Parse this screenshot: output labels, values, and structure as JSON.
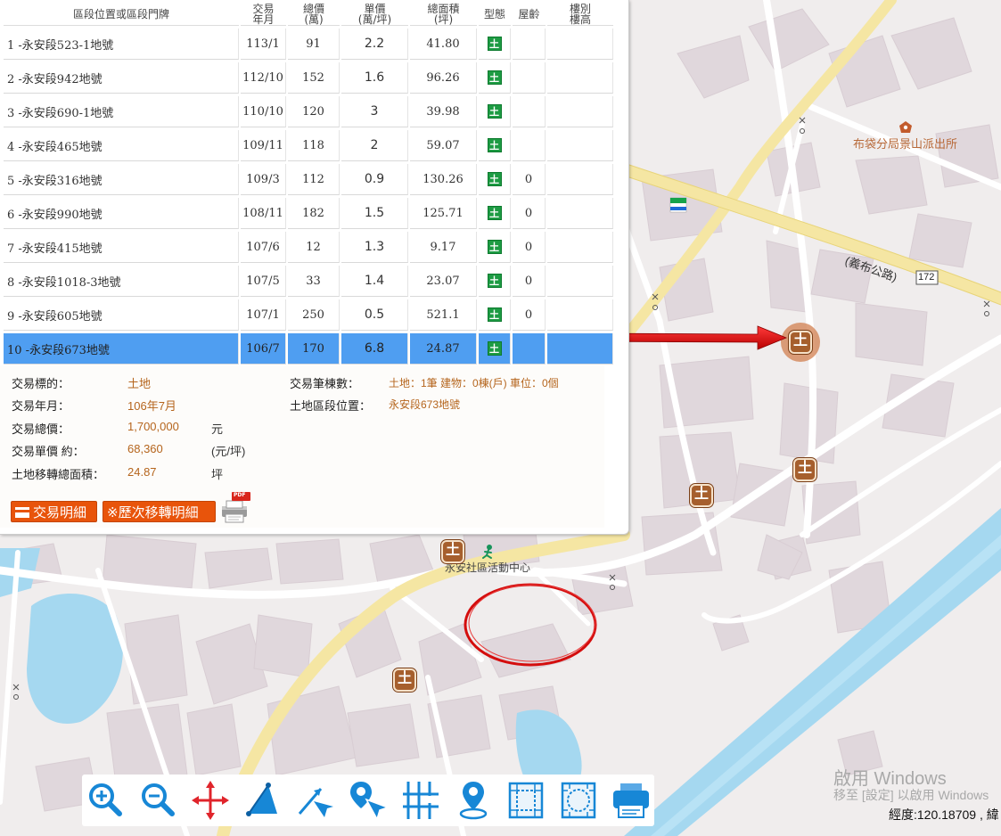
{
  "table": {
    "headers": [
      {
        "l1": "區段位置或區段門牌",
        "l2": ""
      },
      {
        "l1": "交易",
        "l2": "年月"
      },
      {
        "l1": "總價",
        "l2": "(萬)"
      },
      {
        "l1": "單價",
        "l2": "(萬/坪)"
      },
      {
        "l1": "總面積",
        "l2": "(坪)"
      },
      {
        "l1": "型態",
        "l2": ""
      },
      {
        "l1": "屋齡",
        "l2": ""
      },
      {
        "l1": "樓別",
        "l2": "樓高"
      }
    ],
    "type_badge": "土",
    "rows": [
      {
        "addr": "1 -永安段523-1地號",
        "date": "113/1",
        "total": "91",
        "unit": "2.2",
        "area": "41.80",
        "age": ""
      },
      {
        "addr": "2 -永安段942地號",
        "date": "112/10",
        "total": "152",
        "unit": "1.6",
        "area": "96.26",
        "age": ""
      },
      {
        "addr": "3 -永安段690-1地號",
        "date": "110/10",
        "total": "120",
        "unit": "3",
        "area": "39.98",
        "age": ""
      },
      {
        "addr": "4 -永安段465地號",
        "date": "109/11",
        "total": "118",
        "unit": "2",
        "area": "59.07",
        "age": ""
      },
      {
        "addr": "5 -永安段316地號",
        "date": "109/3",
        "total": "112",
        "unit": "0.9",
        "area": "130.26",
        "age": "0"
      },
      {
        "addr": "6 -永安段990地號",
        "date": "108/11",
        "total": "182",
        "unit": "1.5",
        "area": "125.71",
        "age": "0"
      },
      {
        "addr": "7 -永安段415地號",
        "date": "107/6",
        "total": "12",
        "unit": "1.3",
        "area": "9.17",
        "age": "0"
      },
      {
        "addr": "8 -永安段1018-3地號",
        "date": "107/5",
        "total": "33",
        "unit": "1.4",
        "area": "23.07",
        "age": "0"
      },
      {
        "addr": "9 -永安段605地號",
        "date": "107/1",
        "total": "250",
        "unit": "0.5",
        "area": "521.1",
        "age": "0"
      },
      {
        "addr": "10 -永安段673地號",
        "date": "106/7",
        "total": "170",
        "unit": "6.8",
        "area": "24.87",
        "age": ""
      }
    ]
  },
  "detail": {
    "subject_label": "交易標的：",
    "subject_value": "土地",
    "date_label": "交易年月：",
    "date_value": "106年7月",
    "total_label": "交易總價：",
    "total_value": "1,700,000",
    "total_unit": "元",
    "unit_label": "交易單價 約：",
    "unit_value": "68,360",
    "unit_unit": "(元/坪)",
    "area_label": "土地移轉總面積：",
    "area_value": "24.87",
    "area_unit": "坪",
    "count_label": "交易筆棟數：",
    "count_value": "土地：1筆 建物：0棟(戶) 車位：0個",
    "location_label": "土地區段位置：",
    "location_value": "永安段673地號"
  },
  "buttons": {
    "details": "交易明細",
    "history": "※歷次移轉明細",
    "pdf_badge": "PDF"
  },
  "map": {
    "police": "布袋分局景山派出所",
    "road": "(義布公路)",
    "route_no": "172",
    "community": "永安社區活動中心",
    "marker_label": "土",
    "coord_label": "經度:120.18709 , 緯",
    "windows_title": "啟用 Windows",
    "windows_sub": "移至 [設定] 以啟用 Windows",
    "road_marker": "O"
  },
  "toolbar": [
    {
      "name": "zoom-in-tool",
      "icon": "zoom-in-icon"
    },
    {
      "name": "zoom-out-tool",
      "icon": "zoom-out-icon"
    },
    {
      "name": "pan-tool",
      "icon": "move-arrows-icon"
    },
    {
      "name": "measure-area-tool",
      "icon": "triangle-area-icon"
    },
    {
      "name": "measure-distance-tool",
      "icon": "ruler-arrow-icon"
    },
    {
      "name": "point-query-tool",
      "icon": "pin-pointer-icon"
    },
    {
      "name": "road-tool",
      "icon": "road-grid-icon"
    },
    {
      "name": "location-tool",
      "icon": "location-pin-icon"
    },
    {
      "name": "full-extent-tool",
      "icon": "extent-square-icon"
    },
    {
      "name": "circle-extent-tool",
      "icon": "extent-circle-icon"
    },
    {
      "name": "print-tool",
      "icon": "printer-icon"
    }
  ],
  "colors": {
    "selected_row": "#4f9ef1",
    "land_badge": "#1d9b43",
    "value_text": "#b5651d",
    "button_bg": "#e8540b",
    "marker": "#a65f2d",
    "arrow": "#e01010",
    "toolbar_icon": "#1787d6"
  }
}
